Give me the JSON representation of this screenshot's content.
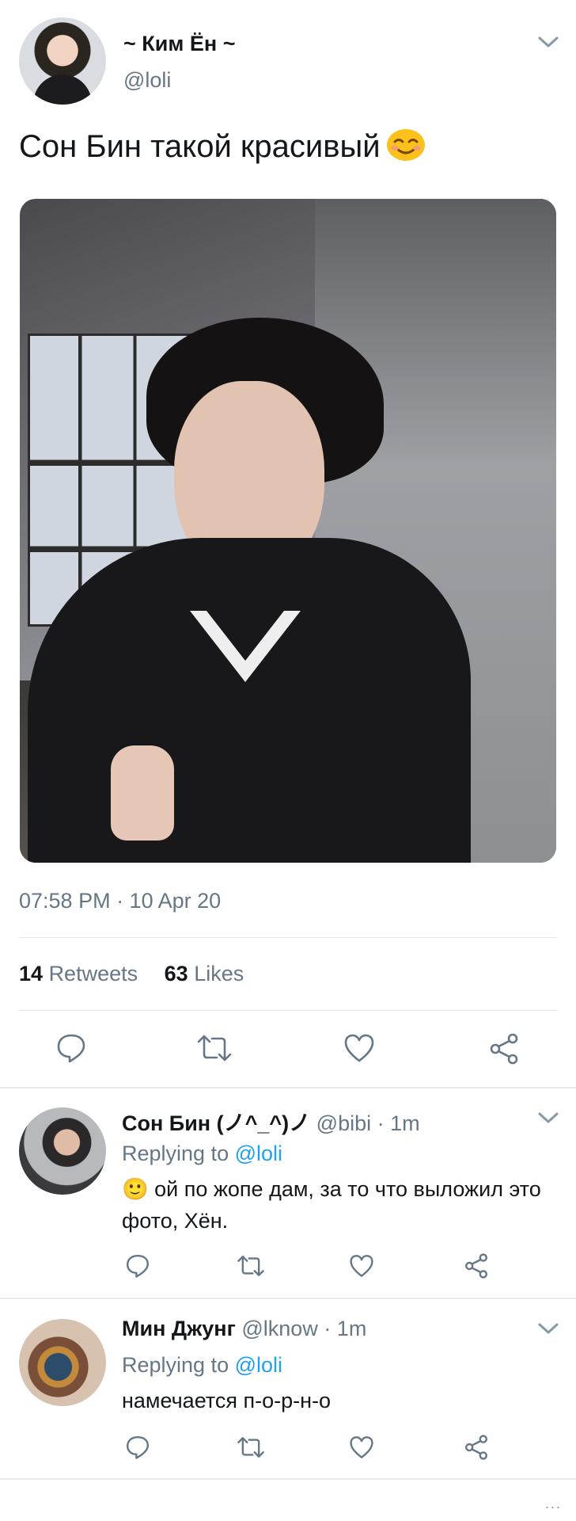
{
  "tweet": {
    "author_name": "~ Ким Ён ~",
    "author_handle": "@loli",
    "text": "Сон Бин такой красивый",
    "emoji": "smiling-face-emoji",
    "timestamp": "07:58 PM · 10 Apr 20",
    "retweets_count": "14",
    "retweets_label": "Retweets",
    "likes_count": "63",
    "likes_label": "Likes"
  },
  "replies": [
    {
      "name": "Сон Бин (ノ^_^)ノ",
      "handle_time": "@bibi · 1m",
      "replying_prefix": "Replying to",
      "replying_link": "@loli",
      "text": "🙂 ой по жопе дам, за то что выложил это фото, Хён."
    },
    {
      "name": "Мин Джунг",
      "handle_time": "@lknow · 1m",
      "replying_prefix": "Replying to",
      "replying_link": "@loli",
      "text": "намечается п-о-р-н-о"
    }
  ],
  "icons": {
    "reply": "reply-icon",
    "retweet": "retweet-icon",
    "like": "heart-icon",
    "share": "share-icon",
    "menu": "chevron-down-icon"
  },
  "colors": {
    "link": "#1da1f2",
    "secondary_text": "#657786",
    "icon": "#657786"
  },
  "footer_more": "..."
}
